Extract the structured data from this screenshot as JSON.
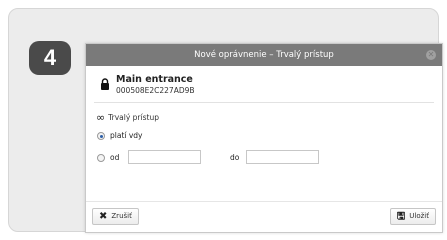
{
  "step": "4",
  "dialog": {
    "title": "Nové oprávnenie – Trvalý prístup",
    "close_icon": "close-icon",
    "entrance": {
      "icon": "lock-icon",
      "name": "Main entrance",
      "code": "000508E2C227AD9B"
    },
    "mode": {
      "icon": "infinity-icon",
      "label": "Trvalý prístup"
    },
    "options": {
      "always_label": "platí vdy",
      "always_selected": true,
      "from_label": "od",
      "to_label": "do",
      "from_value": "",
      "to_value": ""
    },
    "buttons": {
      "cancel_label": "Zrušiť",
      "save_label": "Uložiť"
    }
  }
}
